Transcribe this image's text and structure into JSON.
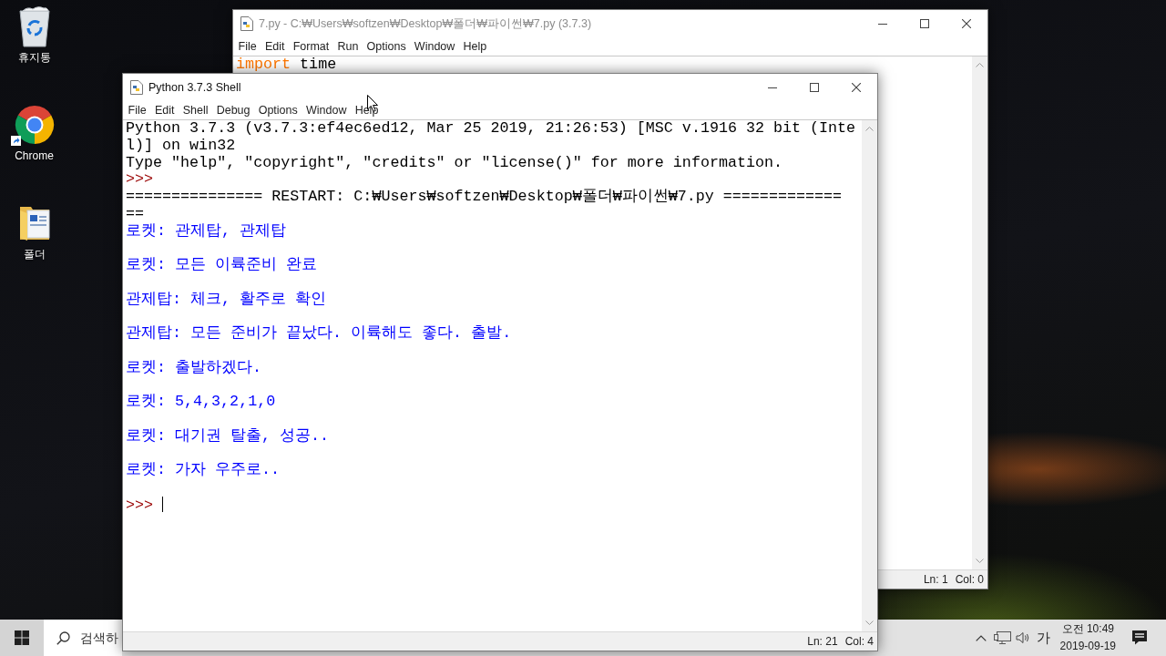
{
  "desktop": {
    "icons": [
      {
        "kind": "recycle-bin",
        "label": "휴지통",
        "shortcut": false
      },
      {
        "kind": "chrome",
        "label": "Chrome",
        "shortcut": true
      },
      {
        "kind": "folder",
        "label": "폴더",
        "shortcut": false
      }
    ]
  },
  "windows": [
    {
      "kind": "editor",
      "active": false,
      "title": "7.py - C:₩Users₩softzen₩Desktop₩폴더₩파이썬₩7.py (3.7.3)",
      "menu": [
        "File",
        "Edit",
        "Format",
        "Run",
        "Options",
        "Window",
        "Help"
      ],
      "code": [
        [
          {
            "kind": "keyword",
            "text": "import"
          },
          {
            "kind": "name",
            "text": "time"
          }
        ]
      ],
      "status": [
        "Ln: 1",
        "Col: 0"
      ]
    },
    {
      "kind": "shell",
      "active": true,
      "title": "Python 3.7.3 Shell",
      "menu": [
        "File",
        "Edit",
        "Shell",
        "Debug",
        "Options",
        "Window",
        "Help"
      ],
      "lines": [
        {
          "kind": "info",
          "text": "Python 3.7.3 (v3.7.3:ef4ec6ed12, Mar 25 2019, 21:26:53) [MSC v.1916 32 bit (Inte",
          "cursor": false
        },
        {
          "kind": "info",
          "text": "l)] on win32",
          "cursor": false
        },
        {
          "kind": "info",
          "text": "Type \"help\", \"copyright\", \"credits\" or \"license()\" for more information.",
          "cursor": false
        },
        {
          "kind": "prompt",
          "text": ">>>",
          "cursor": false
        },
        {
          "kind": "info",
          "text": "=============== RESTART: C:₩Users₩softzen₩Desktop₩폴더₩파이썬₩7.py =============",
          "cursor": false
        },
        {
          "kind": "info",
          "text": "==",
          "cursor": false
        },
        {
          "kind": "stdout",
          "text": "로켓: 관제탑, 관제탑",
          "cursor": false
        },
        {
          "kind": "stdout",
          "text": "로켓: 모든 이륙준비 완료",
          "cursor": false
        },
        {
          "kind": "stdout",
          "text": "관제탑: 체크, 활주로 확인",
          "cursor": false
        },
        {
          "kind": "stdout",
          "text": "관제탑: 모든 준비가 끝났다. 이륙해도 좋다. 출발.",
          "cursor": false
        },
        {
          "kind": "stdout",
          "text": "로켓: 출발하겠다.",
          "cursor": false
        },
        {
          "kind": "stdout",
          "text": "로켓: 5,4,3,2,1,0",
          "cursor": false
        },
        {
          "kind": "stdout",
          "text": "로켓: 대기권 탈출, 성공..",
          "cursor": false
        },
        {
          "kind": "stdout",
          "text": "로켓: 가자 우주로..",
          "cursor": false
        },
        {
          "kind": "prompt",
          "text": ">>>",
          "cursor": true
        }
      ],
      "status": [
        "Ln: 21",
        "Col: 4"
      ]
    }
  ],
  "taskbar": {
    "search": {
      "placeholder": "검색하"
    },
    "ime": "가",
    "clock": {
      "time": "오전 10:49",
      "date": "2019-09-19"
    }
  }
}
